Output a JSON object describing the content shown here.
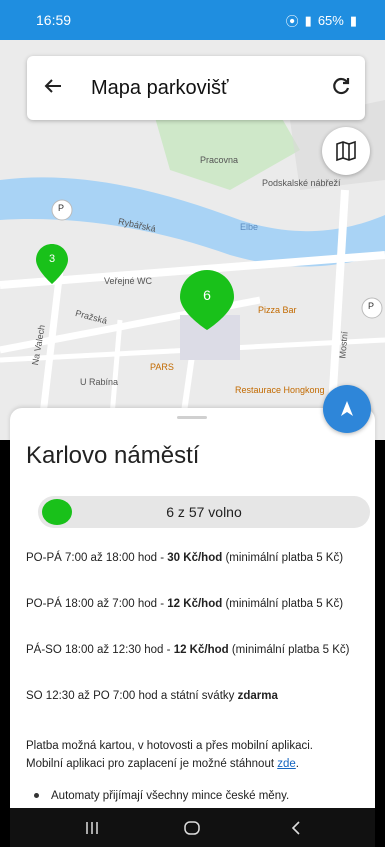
{
  "status_bar": {
    "time": "16:59",
    "battery": "65%"
  },
  "header": {
    "title": "Mapa parkovišť"
  },
  "map": {
    "labels": [
      "Pracovna",
      "Podskalské nábřeží",
      "Rybářská",
      "Veřejné WC",
      "Pražská",
      "Pizza Bar",
      "PARS",
      "U Rabína",
      "Na Valech",
      "Mostní",
      "Restaurace Hongkong",
      "Elbe"
    ],
    "markers": [
      {
        "count": "3"
      },
      {
        "count": "6"
      }
    ],
    "parking_signs": [
      "P",
      "P"
    ]
  },
  "detail": {
    "title": "Karlovo náměstí",
    "availability": "6 z 57 volno",
    "rates": [
      {
        "prefix": "PO-PÁ 7:00 až 18:00 hod - ",
        "price": "30 Kč/hod",
        "suffix": " (minimální platba 5 Kč)"
      },
      {
        "prefix": "PO-PÁ 18:00 až 7:00 hod - ",
        "price": "12 Kč/hod",
        "suffix": " (minimální platba 5 Kč)"
      },
      {
        "prefix": "PÁ-SO 18:00 až 12:30 hod - ",
        "price": "12 Kč/hod",
        "suffix": " (minimální platba 5 Kč)"
      },
      {
        "prefix": "SO 12:30 až PO 7:00 hod a státní svátky ",
        "price": "zdarma",
        "suffix": ""
      }
    ],
    "payment_line1": "Platba možná kartou, v hotovosti a přes mobilní aplikaci.",
    "payment_line2": "Mobilní aplikaci pro zaplacení je možné stáhnout ",
    "payment_link": "zde",
    "payment_end": ".",
    "bullet": "Automaty přijímají všechny mince české měny."
  },
  "colors": {
    "accent": "#2e86d9",
    "available": "#19c11a",
    "marker": "#19c11a"
  }
}
